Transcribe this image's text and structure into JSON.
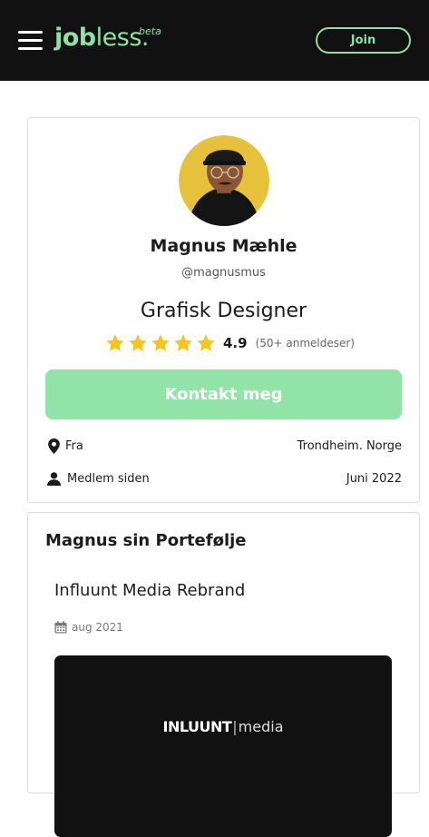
{
  "header": {
    "logo_part1": "job",
    "logo_part2": "less.",
    "logo_badge": "beta",
    "join_label": "Join",
    "colors": {
      "background": "#111111",
      "accent": "#8fe0a5"
    }
  },
  "profile": {
    "name": "Magnus Mæhle",
    "username": "@magnusmus",
    "role": "Grafisk Designer",
    "rating": {
      "value": 4.9,
      "value_text": "4.9",
      "count_text": "(50+ anmeldeser)",
      "stars": 5,
      "star_color": "#f5c518"
    },
    "contact_label": "Kontakt meg",
    "contact_color": "#92e3a8",
    "info": [
      {
        "icon": "map-pin-icon",
        "label": "Fra",
        "value": "Trondheim. Norge"
      },
      {
        "icon": "user-icon",
        "label": "Medlem siden",
        "value": "Juni 2022"
      }
    ]
  },
  "portfolio": {
    "title": "Magnus sin Portefølje",
    "projects": [
      {
        "title": "Influunt Media Rebrand",
        "date_icon": "calendar-icon",
        "date": "aug 2021",
        "image_brand": "INLUUNT",
        "image_separator": "|",
        "image_sub": "media"
      }
    ]
  }
}
